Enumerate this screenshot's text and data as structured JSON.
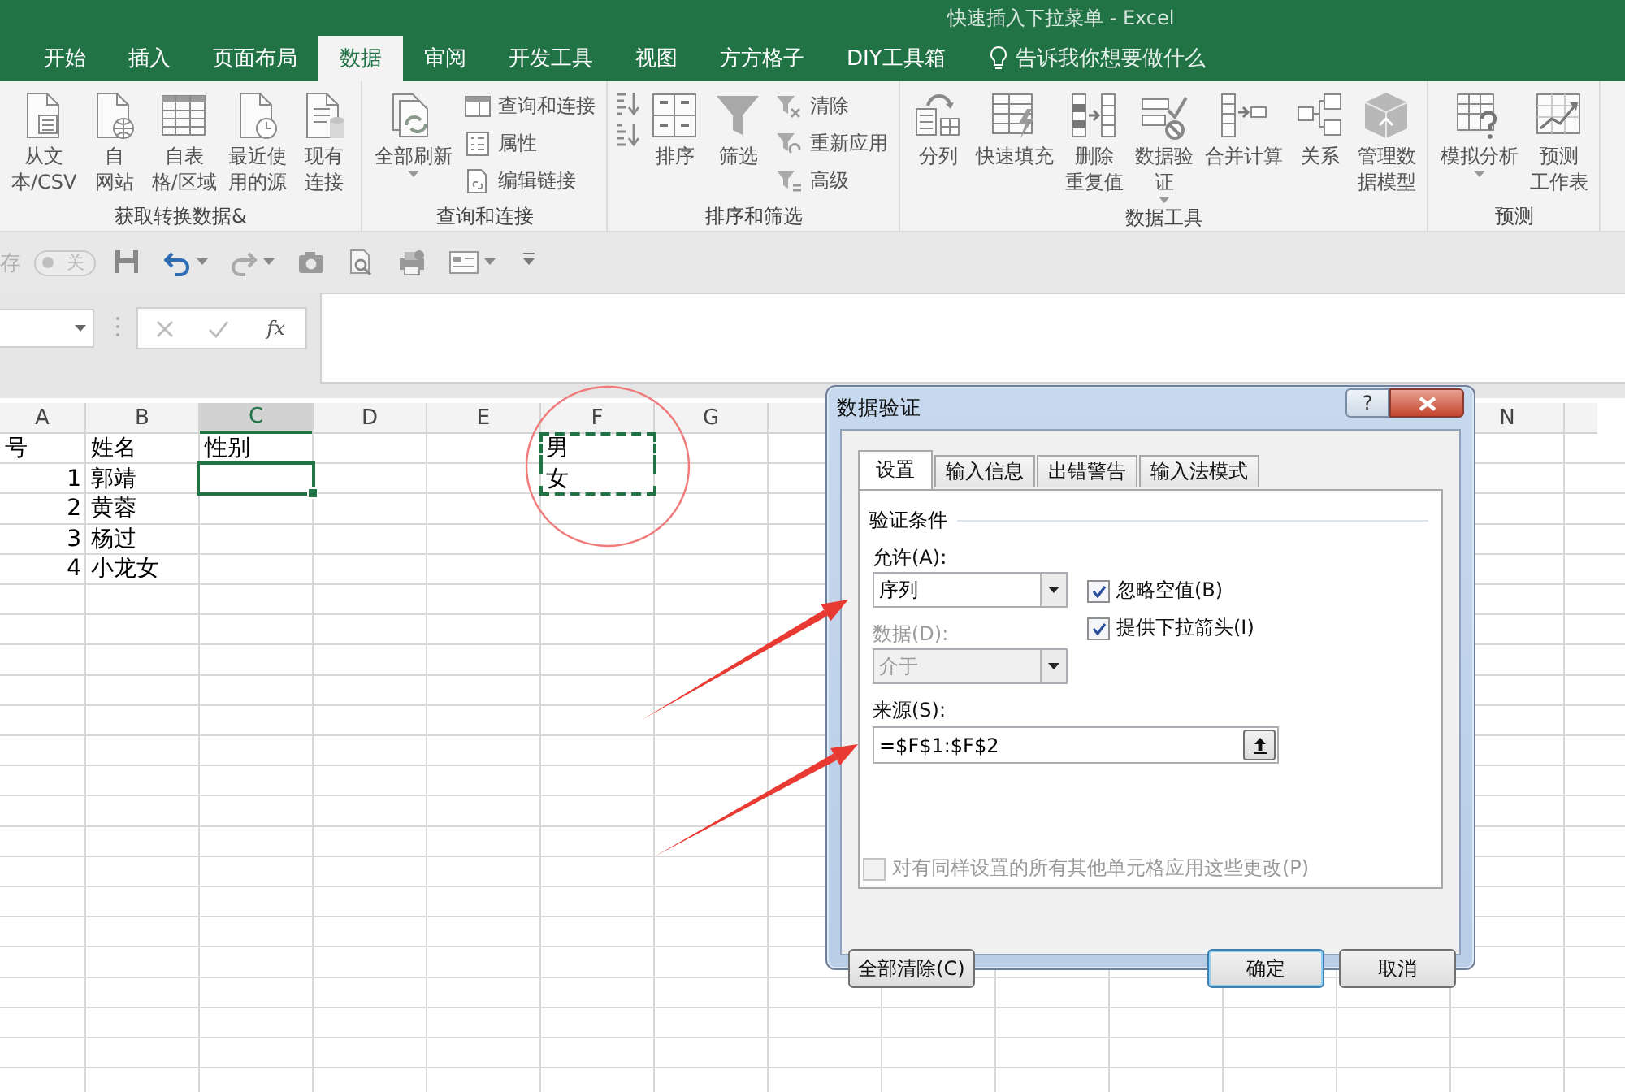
{
  "window": {
    "title": "快速插入下拉菜单 - Excel"
  },
  "ribbon_tabs": [
    {
      "label": "开始",
      "selected": false
    },
    {
      "label": "插入",
      "selected": false
    },
    {
      "label": "页面布局",
      "selected": false
    },
    {
      "label": "数据",
      "selected": true
    },
    {
      "label": "审阅",
      "selected": false
    },
    {
      "label": "开发工具",
      "selected": false
    },
    {
      "label": "视图",
      "selected": false
    },
    {
      "label": "方方格子",
      "selected": false
    },
    {
      "label": "DIY工具箱",
      "selected": false
    }
  ],
  "tell_me": {
    "placeholder": "告诉我你想要做什么"
  },
  "ribbon_groups": [
    {
      "label": "获取转换数据&",
      "commands": [
        {
          "kind": "large",
          "label": "从文本/CSV"
        },
        {
          "kind": "large",
          "label": "自网站"
        },
        {
          "kind": "large",
          "label": "自表格/区域"
        },
        {
          "kind": "large",
          "label": "最近使用的源"
        },
        {
          "kind": "large",
          "label": "现有连接"
        }
      ]
    },
    {
      "label": "查询和连接",
      "commands": [
        {
          "kind": "large",
          "label": "全部刷新",
          "menu": true
        },
        {
          "kind": "stack",
          "items": [
            {
              "label": "查询和连接"
            },
            {
              "label": "属性"
            },
            {
              "label": "编辑链接"
            }
          ]
        }
      ]
    },
    {
      "label": "排序和筛选",
      "commands": [
        {
          "kind": "stack",
          "items": [
            {
              "kind": "icon"
            },
            {
              "kind": "icon"
            }
          ]
        },
        {
          "kind": "large",
          "label": "排序"
        },
        {
          "kind": "large",
          "label": "筛选"
        },
        {
          "kind": "stack",
          "items": [
            {
              "label": "清除"
            },
            {
              "label": "重新应用"
            },
            {
              "label": "高级"
            }
          ]
        }
      ]
    },
    {
      "label": "数据工具",
      "commands": [
        {
          "kind": "large",
          "label": "分列"
        },
        {
          "kind": "large",
          "label": "快速填充"
        },
        {
          "kind": "large",
          "label": "删除重复值"
        },
        {
          "kind": "large",
          "label": "数据验证",
          "menu": true
        },
        {
          "kind": "large",
          "label": "合并计算"
        },
        {
          "kind": "large",
          "label": "关系"
        },
        {
          "kind": "large",
          "label": "管理数据模型"
        }
      ]
    },
    {
      "label": "预测",
      "commands": [
        {
          "kind": "large",
          "label": "模拟分析",
          "menu": true
        },
        {
          "kind": "large",
          "label": "预测工作表"
        }
      ]
    }
  ],
  "quick_access": {
    "autosave": {
      "label": "存",
      "state": "关",
      "on": false
    }
  },
  "formula_bar": {
    "function_button": "fx"
  },
  "sheet": {
    "columns_left": [
      {
        "label": "A",
        "selected": false
      },
      {
        "label": "B",
        "selected": false
      },
      {
        "label": "C",
        "selected": true
      },
      {
        "label": "D",
        "selected": false
      },
      {
        "label": "E",
        "selected": false
      },
      {
        "label": "F",
        "selected": false
      },
      {
        "label": "G",
        "selected": false
      }
    ],
    "columns_right": [
      {
        "label": "N",
        "selected": false
      }
    ],
    "rows": [
      {
        "cells": [
          {
            "text": "号"
          },
          {
            "text": "姓名"
          },
          {
            "text": "性别"
          },
          {},
          {},
          {
            "text": "男",
            "copied": true
          }
        ]
      },
      {
        "cells": [
          {
            "text": "1",
            "kind": "number"
          },
          {
            "text": "郭靖"
          },
          {
            "active": true
          },
          {},
          {},
          {
            "text": "女",
            "copied": true
          }
        ]
      },
      {
        "cells": [
          {
            "text": "2",
            "kind": "number"
          },
          {
            "text": "黄蓉"
          }
        ]
      },
      {
        "cells": [
          {
            "text": "3",
            "kind": "number"
          },
          {
            "text": "杨过"
          }
        ]
      },
      {
        "cells": [
          {
            "text": "4",
            "kind": "number"
          },
          {
            "text": "小龙女"
          }
        ]
      }
    ]
  },
  "dialog": {
    "title": "数据验证",
    "help_button": "?",
    "tabs": [
      {
        "label": "设置",
        "selected": true
      },
      {
        "label": "输入信息",
        "selected": false
      },
      {
        "label": "出错警告",
        "selected": false
      },
      {
        "label": "输入法模式",
        "selected": false
      }
    ],
    "section_title": "验证条件",
    "allow": {
      "label": "允许(A):",
      "value": "序列",
      "disabled": false
    },
    "data": {
      "label": "数据(D):",
      "value": "介于",
      "disabled": true
    },
    "options": [
      {
        "label": "忽略空值(B)",
        "checked": true
      },
      {
        "label": "提供下拉箭头(I)",
        "checked": true
      }
    ],
    "source": {
      "label": "来源(S):",
      "value": "=$F$1:$F$2"
    },
    "apply_all": {
      "label": "对有同样设置的所有其他单元格应用这些更改(P)",
      "checked": false,
      "disabled": true
    },
    "buttons": [
      {
        "label": "全部清除(C)",
        "default": false
      },
      {
        "label": "确定",
        "default": true
      },
      {
        "label": "取消",
        "default": false
      }
    ]
  },
  "annotations": [
    {
      "kind": "circle"
    },
    {
      "kind": "arrow"
    },
    {
      "kind": "arrow"
    }
  ]
}
